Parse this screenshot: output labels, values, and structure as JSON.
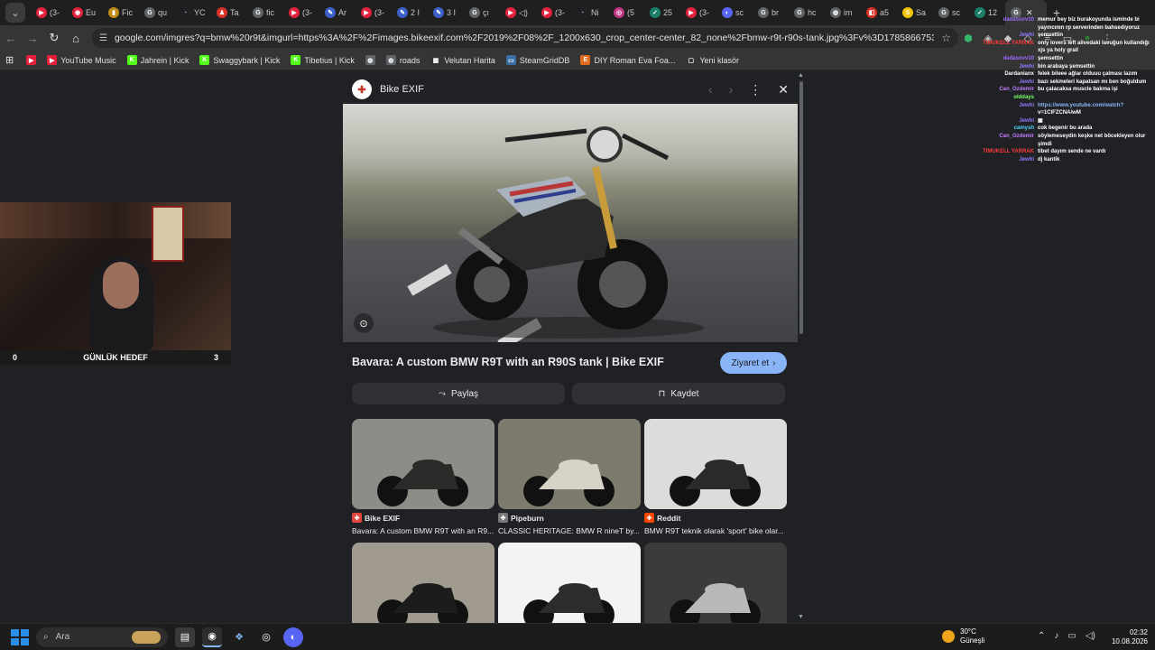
{
  "browser": {
    "tabs": [
      {
        "label": "(3-",
        "color": "#e5203b",
        "glyph": "▶"
      },
      {
        "label": "Eu",
        "color": "#e5203b",
        "glyph": "◉"
      },
      {
        "label": "Fic",
        "color": "#c28d16",
        "glyph": "▮"
      },
      {
        "label": "qu",
        "color": "#5f6368",
        "glyph": "G"
      },
      {
        "label": "YC",
        "color": "#202124",
        "glyph": "·"
      },
      {
        "label": "Ta",
        "color": "#d93025",
        "glyph": "♟"
      },
      {
        "label": "fic",
        "color": "#5f6368",
        "glyph": "G"
      },
      {
        "label": "(3-",
        "color": "#e5203b",
        "glyph": "▶"
      },
      {
        "label": "Ar",
        "color": "#3b5fc7",
        "glyph": "✎"
      },
      {
        "label": "(3-",
        "color": "#e5203b",
        "glyph": "▶"
      },
      {
        "label": "2 I",
        "color": "#3b5fc7",
        "glyph": "✎"
      },
      {
        "label": "3 I",
        "color": "#3b5fc7",
        "glyph": "✎"
      },
      {
        "label": "çı",
        "color": "#5f6368",
        "glyph": "G"
      },
      {
        "label": "◁)",
        "color": "#e5203b",
        "glyph": "▶"
      },
      {
        "label": "(3-",
        "color": "#e5203b",
        "glyph": "▶"
      },
      {
        "label": "Ni",
        "color": "#202124",
        "glyph": "·"
      },
      {
        "label": "(5",
        "color": "#c13584",
        "glyph": "◎"
      },
      {
        "label": "25",
        "color": "#1b7f6b",
        "glyph": "✓"
      },
      {
        "label": "(3-",
        "color": "#e5203b",
        "glyph": "▶"
      },
      {
        "label": "sc",
        "color": "#5865f2",
        "glyph": "◐"
      },
      {
        "label": "br",
        "color": "#5f6368",
        "glyph": "G"
      },
      {
        "label": "hc",
        "color": "#5f6368",
        "glyph": "G"
      },
      {
        "label": "im",
        "color": "#5f6368",
        "glyph": "◍"
      },
      {
        "label": "a5",
        "color": "#d93025",
        "glyph": "◧"
      },
      {
        "label": "Sa",
        "color": "#f2c200",
        "glyph": "S"
      },
      {
        "label": "sc",
        "color": "#5f6368",
        "glyph": "G"
      },
      {
        "label": "12",
        "color": "#1b7f6b",
        "glyph": "✓"
      }
    ],
    "active_tab": {
      "label": "",
      "color": "#5f6368",
      "glyph": "G"
    },
    "address": "google.com/imgres?q=bmw%20r9t&imgurl=https%3A%2F%2Fimages.bikeexif.com%2F2019%2F08%2F_1200x630_crop_center-center_82_none%2Fbmw-r9t-r90s-tank.jpg%3Fv%3D1785866753&imgrefurl=https%3A%2F..."
  },
  "bookmarks": [
    {
      "label": "",
      "color": "#e5203b",
      "glyph": "▶"
    },
    {
      "label": "YouTube Music",
      "color": "#e5203b",
      "glyph": "▶"
    },
    {
      "label": "Jahrein | Kick",
      "color": "#53fc18",
      "glyph": "K"
    },
    {
      "label": "Swaggybark | Kick",
      "color": "#53fc18",
      "glyph": "K"
    },
    {
      "label": "Tibetius | Kick",
      "color": "#53fc18",
      "glyph": "K"
    },
    {
      "label": "",
      "color": "#5f6368",
      "glyph": "◍"
    },
    {
      "label": "roads",
      "color": "#5f6368",
      "glyph": "◍"
    },
    {
      "label": "Velutan Harita",
      "color": "#333333",
      "glyph": "▦"
    },
    {
      "label": "SteamGridDB",
      "color": "#3a6ea5",
      "glyph": "▭"
    },
    {
      "label": "DIY Roman Eva Foa...",
      "color": "#e26a1c",
      "glyph": "E"
    },
    {
      "label": "Yeni klasör",
      "color": "#353535",
      "glyph": "▢"
    }
  ],
  "overlay": {
    "goal_left": "0",
    "goal_label": "GÜNLÜK HEDEF",
    "goal_right": "3"
  },
  "chat": [
    {
      "user": "dadasovv10",
      "ucolor": "#9d6bff",
      "text": "memur bey biz burakoyunda isminde bi"
    },
    {
      "user": "",
      "ucolor": "#9d6bff",
      "text": "yayıncının rp serverinden bahsediyoruz"
    },
    {
      "user": "Jewhi",
      "ucolor": "#8e7cff",
      "text": "şemsettin"
    },
    {
      "user": "TIMUKELL YARRAK",
      "ucolor": "#ff3b3b",
      "text": "only lovers left alivedaki lavuğun kullandığı"
    },
    {
      "user": "",
      "ucolor": "#ff3b3b",
      "text": "xjs ya holy grail"
    },
    {
      "user": "dadasovv10",
      "ucolor": "#9d6bff",
      "text": "şemsettin"
    },
    {
      "user": "Jewhi",
      "ucolor": "#8e7cff",
      "text": "bin arabaya şemsettin"
    },
    {
      "user": "Dardanianx",
      "ucolor": "#ffffff",
      "text": "felek bileee ağlar olduuu çalması lazım"
    },
    {
      "user": "Jewhi",
      "ucolor": "#8e7cff",
      "text": "bazı sekmeleri kapatsan mı ben boğuldum"
    },
    {
      "user": "Can_Ozdemir",
      "ucolor": "#c07cff",
      "text": "bu çalacaksa muscle bakma işi"
    },
    {
      "user": "olddays",
      "ucolor": "#7cff6b",
      "text": ""
    },
    {
      "user": "Jewhi",
      "ucolor": "#8e7cff",
      "text": "https://www.youtube.com/watch?"
    },
    {
      "user": "",
      "ucolor": "#8e7cff",
      "text": "v=1CIFZCNA/wM"
    },
    {
      "user": "Jewhi",
      "ucolor": "#8e7cff",
      "text": "▣"
    },
    {
      "user": "camysh",
      "ucolor": "#4fd1ff",
      "text": "cok begenir bu arada"
    },
    {
      "user": "Can_Ozdemir",
      "ucolor": "#c07cff",
      "text": "söylemeseydin keşke net böcekleyen olur"
    },
    {
      "user": "",
      "ucolor": "#c07cff",
      "text": "şimdi"
    },
    {
      "user": "TIMUKELL YARRAK",
      "ucolor": "#ff3b3b",
      "text": "tibet dayım sende ne vardı"
    },
    {
      "user": "Jewhi",
      "ucolor": "#8e7cff",
      "text": "dj kantik"
    }
  ],
  "viewer": {
    "source_name": "Bike EXIF",
    "title": "Bavara: A custom BMW R9T with an R90S tank | Bike EXIF",
    "visit_label": "Ziyaret et",
    "share_label": "Paylaş",
    "save_label": "Kaydet",
    "related": [
      {
        "source": "Bike EXIF",
        "source_color": "#e0463d",
        "caption": "Bavara: A custom BMW R9T with an R9...",
        "bg": "#8e8c86",
        "bike": "#2b2a28"
      },
      {
        "source": "Pipeburn",
        "source_color": "#777777",
        "caption": "CLASSIC HERITAGE: BMW R nineT by...",
        "bg": "#7d7a6e",
        "bike": "#d7d3c6"
      },
      {
        "source": "Reddit",
        "source_color": "#ff4500",
        "caption": "BMW R9T teknik olarak 'sport' bike olar...",
        "bg": "#dcdcda",
        "bike": "#2a2a2a"
      },
      {
        "source": "",
        "source_color": "",
        "caption": "",
        "bg": "#a09b8e",
        "bike": "#1c1c1c"
      },
      {
        "source": "",
        "source_color": "",
        "caption": "",
        "bg": "#f3f3f1",
        "bike": "#2c2c2c"
      },
      {
        "source": "",
        "source_color": "",
        "caption": "",
        "bg": "#3b3b3b",
        "bike": "#b9b9b9"
      }
    ]
  },
  "taskbar": {
    "search_placeholder": "Ara",
    "temperature": "30°C",
    "weather": "Güneşli",
    "time": "02:32",
    "date": "10.08.2026"
  }
}
